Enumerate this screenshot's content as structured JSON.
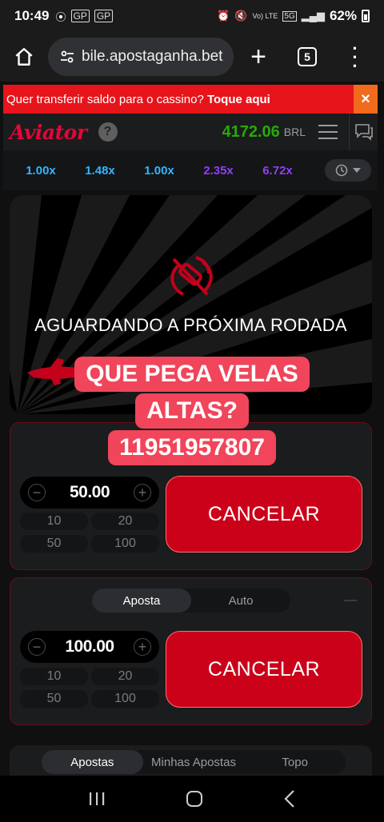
{
  "status_bar": {
    "time": "10:49",
    "left_icons": [
      "GP",
      "GP"
    ],
    "network": "Vo) LTE",
    "net_type": "5G",
    "battery": "62%"
  },
  "browser": {
    "url": "bile.apostaganha.bet",
    "tab_count": "5"
  },
  "promo": {
    "text": "Quer transferir saldo para o cassino?",
    "link": "Toque aqui",
    "close": "×"
  },
  "game": {
    "logo": "Aviator",
    "help": "?",
    "balance": "4172.06",
    "currency": "BRL"
  },
  "history": [
    {
      "value": "1.00x",
      "color": "#34b4ff"
    },
    {
      "value": "1.48x",
      "color": "#34b4ff"
    },
    {
      "value": "1.00x",
      "color": "#34b4ff"
    },
    {
      "value": "2.35x",
      "color": "#913ef8"
    },
    {
      "value": "6.72x",
      "color": "#913ef8"
    }
  ],
  "stage": {
    "waiting_text": "AGUARDANDO A PRÓXIMA RODADA"
  },
  "overlay": {
    "line1": "QUE PEGA VELAS",
    "line2": "ALTAS?",
    "line3": "11951957807"
  },
  "panel1": {
    "amount": "50.00",
    "quick": [
      "10",
      "20",
      "50",
      "100"
    ],
    "cancel_label": "CANCELAR"
  },
  "panel2": {
    "tabs": [
      "Aposta",
      "Auto"
    ],
    "amount": "100.00",
    "quick": [
      "10",
      "20",
      "50",
      "100"
    ],
    "cancel_label": "CANCELAR"
  },
  "bets_tabs": [
    "Apostas",
    "Minhas Apostas",
    "Topo"
  ],
  "colors": {
    "brand_red": "#e50539",
    "balance_green": "#28a909",
    "cancel_red": "#cb011a",
    "overlay_pink": "#f0455a"
  }
}
